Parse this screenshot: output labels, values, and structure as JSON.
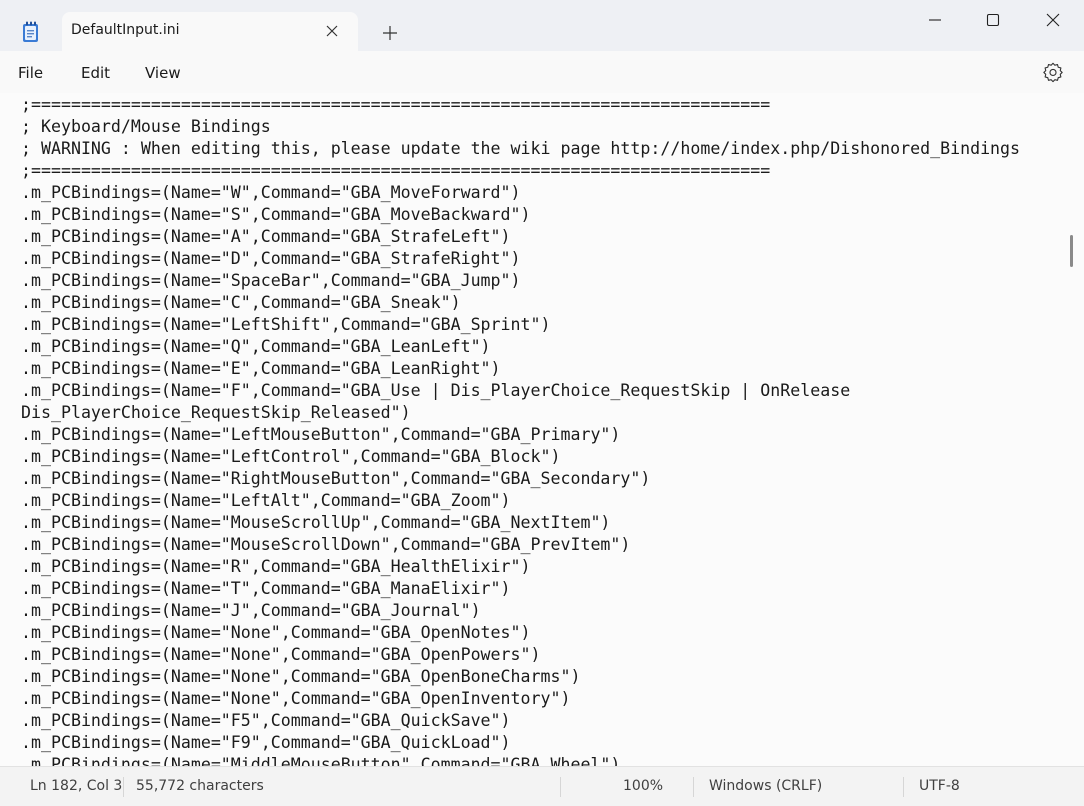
{
  "tab": {
    "title": "DefaultInput.ini"
  },
  "menu": {
    "file": "File",
    "edit": "Edit",
    "view": "View"
  },
  "editor": {
    "lines": [
      ";==========================================================================",
      "; Keyboard/Mouse Bindings",
      "; WARNING : When editing this, please update the wiki page http://home/index.php/Dishonored_Bindings",
      ";==========================================================================",
      ".m_PCBindings=(Name=\"W\",Command=\"GBA_MoveForward\")",
      ".m_PCBindings=(Name=\"S\",Command=\"GBA_MoveBackward\")",
      ".m_PCBindings=(Name=\"A\",Command=\"GBA_StrafeLeft\")",
      ".m_PCBindings=(Name=\"D\",Command=\"GBA_StrafeRight\")",
      ".m_PCBindings=(Name=\"SpaceBar\",Command=\"GBA_Jump\")",
      ".m_PCBindings=(Name=\"C\",Command=\"GBA_Sneak\")",
      ".m_PCBindings=(Name=\"LeftShift\",Command=\"GBA_Sprint\")",
      ".m_PCBindings=(Name=\"Q\",Command=\"GBA_LeanLeft\")",
      ".m_PCBindings=(Name=\"E\",Command=\"GBA_LeanRight\")",
      ".m_PCBindings=(Name=\"F\",Command=\"GBA_Use | Dis_PlayerChoice_RequestSkip | OnRelease",
      "Dis_PlayerChoice_RequestSkip_Released\")",
      ".m_PCBindings=(Name=\"LeftMouseButton\",Command=\"GBA_Primary\")",
      ".m_PCBindings=(Name=\"LeftControl\",Command=\"GBA_Block\")",
      ".m_PCBindings=(Name=\"RightMouseButton\",Command=\"GBA_Secondary\")",
      ".m_PCBindings=(Name=\"LeftAlt\",Command=\"GBA_Zoom\")",
      ".m_PCBindings=(Name=\"MouseScrollUp\",Command=\"GBA_NextItem\")",
      ".m_PCBindings=(Name=\"MouseScrollDown\",Command=\"GBA_PrevItem\")",
      ".m_PCBindings=(Name=\"R\",Command=\"GBA_HealthElixir\")",
      ".m_PCBindings=(Name=\"T\",Command=\"GBA_ManaElixir\")",
      ".m_PCBindings=(Name=\"J\",Command=\"GBA_Journal\")",
      ".m_PCBindings=(Name=\"None\",Command=\"GBA_OpenNotes\")",
      ".m_PCBindings=(Name=\"None\",Command=\"GBA_OpenPowers\")",
      ".m_PCBindings=(Name=\"None\",Command=\"GBA_OpenBoneCharms\")",
      ".m_PCBindings=(Name=\"None\",Command=\"GBA_OpenInventory\")",
      ".m_PCBindings=(Name=\"F5\",Command=\"GBA_QuickSave\")",
      ".m_PCBindings=(Name=\"F9\",Command=\"GBA_QuickLoad\")",
      ".m_PCBindings=(Name=\"MiddleMouseButton\",Command=\"GBA_Wheel\")"
    ]
  },
  "status": {
    "position": "Ln 182, Col 3",
    "characters": "55,772 characters",
    "zoom": "100%",
    "line_ending": "Windows (CRLF)",
    "encoding": "UTF-8"
  },
  "icons": {
    "app": "notepad-icon",
    "close_tab": "close-icon",
    "new_tab": "plus-icon",
    "minimize": "minimize-icon",
    "maximize": "maximize-icon",
    "close_window": "close-icon",
    "settings": "gear-icon"
  }
}
